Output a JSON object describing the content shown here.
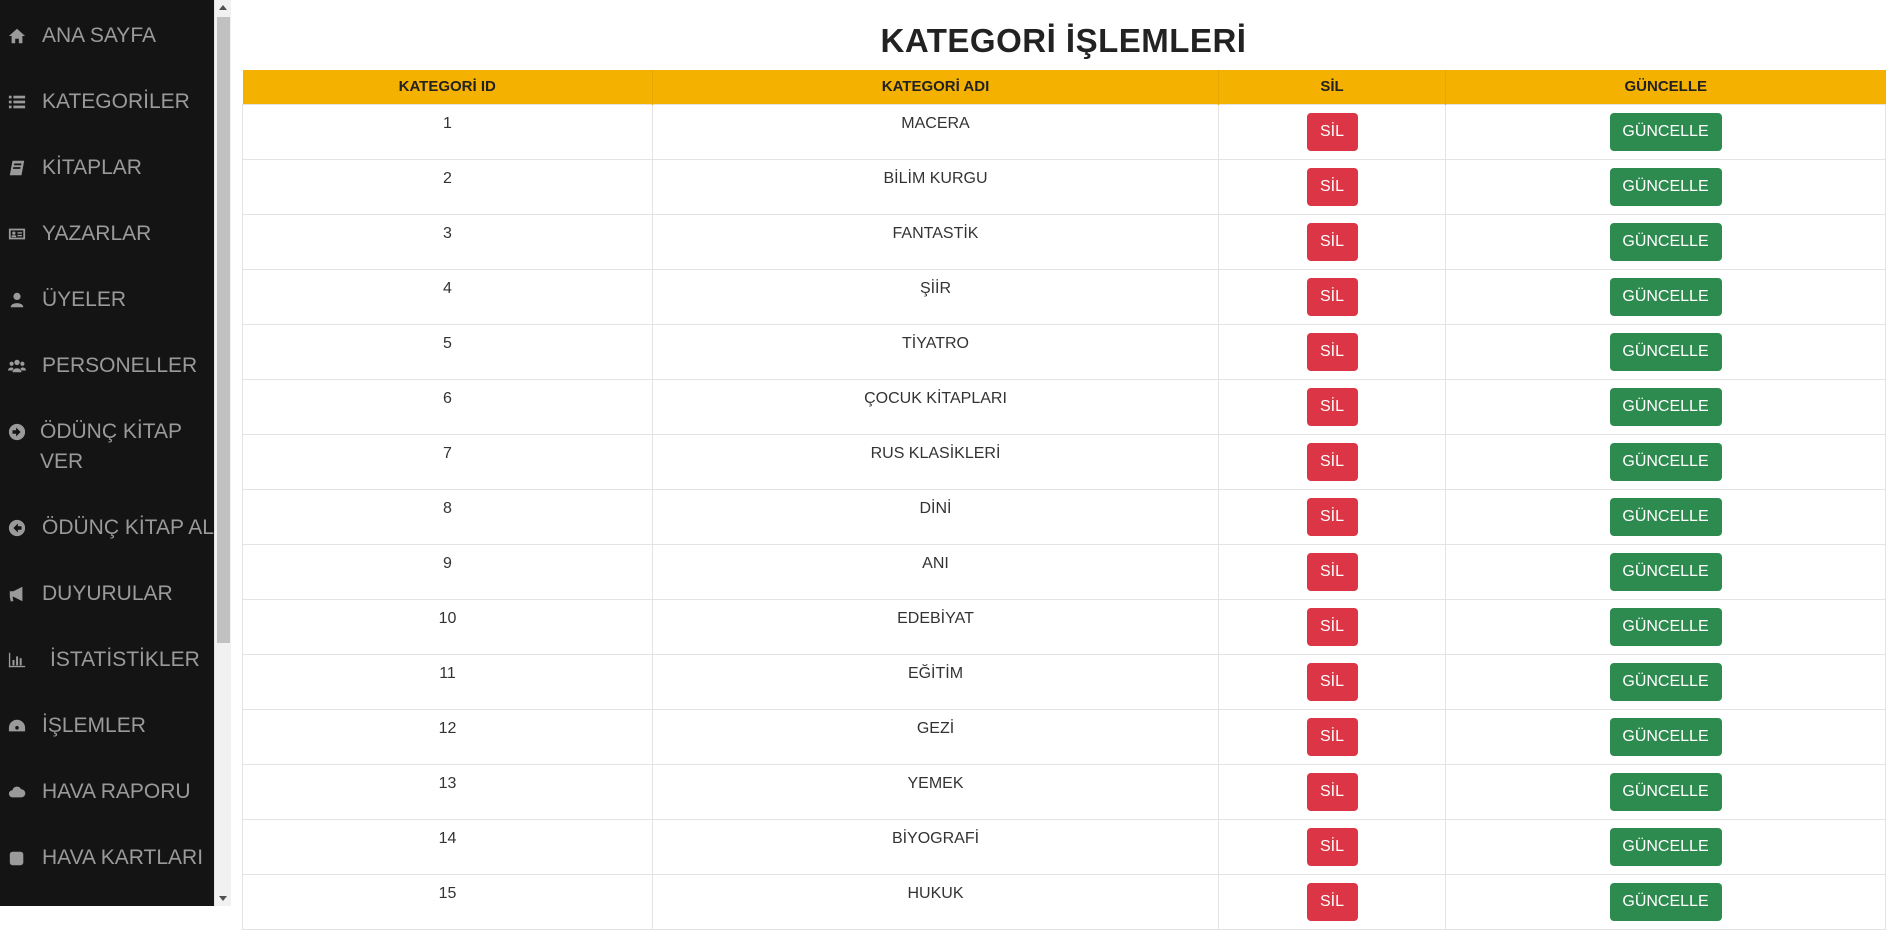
{
  "sidebar": {
    "items": [
      {
        "label": "ANA SAYFA",
        "icon": "home-icon"
      },
      {
        "label": "KATEGORİLER",
        "icon": "list-icon"
      },
      {
        "label": "KİTAPLAR",
        "icon": "book-icon"
      },
      {
        "label": "YAZARLAR",
        "icon": "id-card-icon"
      },
      {
        "label": "ÜYELER",
        "icon": "user-icon"
      },
      {
        "label": "PERSONELLER",
        "icon": "users-icon"
      },
      {
        "label": "ÖDÜNÇ KİTAP VER",
        "icon": "arrow-circle-right-icon"
      },
      {
        "label": "ÖDÜNÇ KİTAP AL",
        "icon": "arrow-circle-left-icon"
      },
      {
        "label": "DUYURULAR",
        "icon": "bullhorn-icon"
      },
      {
        "label": "İSTATİSTİKLER",
        "icon": "bar-chart-icon"
      },
      {
        "label": "İŞLEMLER",
        "icon": "dashboard-icon"
      },
      {
        "label": "HAVA RAPORU",
        "icon": "cloud-icon"
      },
      {
        "label": "HAVA KARTLARI",
        "icon": "square-icon"
      }
    ]
  },
  "page": {
    "title": "KATEGORİ İŞLEMLERİ"
  },
  "table": {
    "headers": [
      "KATEGORİ ID",
      "KATEGORİ ADI",
      "SİL",
      "GÜNCELLE"
    ],
    "delete_label": "SİL",
    "update_label": "GÜNCELLE",
    "rows": [
      {
        "id": "1",
        "name": "MACERA"
      },
      {
        "id": "2",
        "name": "BİLİM KURGU"
      },
      {
        "id": "3",
        "name": "FANTASTİK"
      },
      {
        "id": "4",
        "name": "ŞİİR"
      },
      {
        "id": "5",
        "name": "TİYATRO"
      },
      {
        "id": "6",
        "name": "ÇOCUK KİTAPLARI"
      },
      {
        "id": "7",
        "name": "RUS KLASİKLERİ"
      },
      {
        "id": "8",
        "name": "DİNİ"
      },
      {
        "id": "9",
        "name": "ANI"
      },
      {
        "id": "10",
        "name": "EDEBİYAT"
      },
      {
        "id": "11",
        "name": "EĞİTİM"
      },
      {
        "id": "12",
        "name": "GEZİ"
      },
      {
        "id": "13",
        "name": "YEMEK"
      },
      {
        "id": "14",
        "name": "BİYOGRAFİ"
      },
      {
        "id": "15",
        "name": "HUKUK"
      }
    ]
  },
  "colors": {
    "sidebar_bg": "#141414",
    "header_bg": "#f5b100",
    "delete_button": "#dc3545",
    "update_button": "#2e8b4f"
  }
}
